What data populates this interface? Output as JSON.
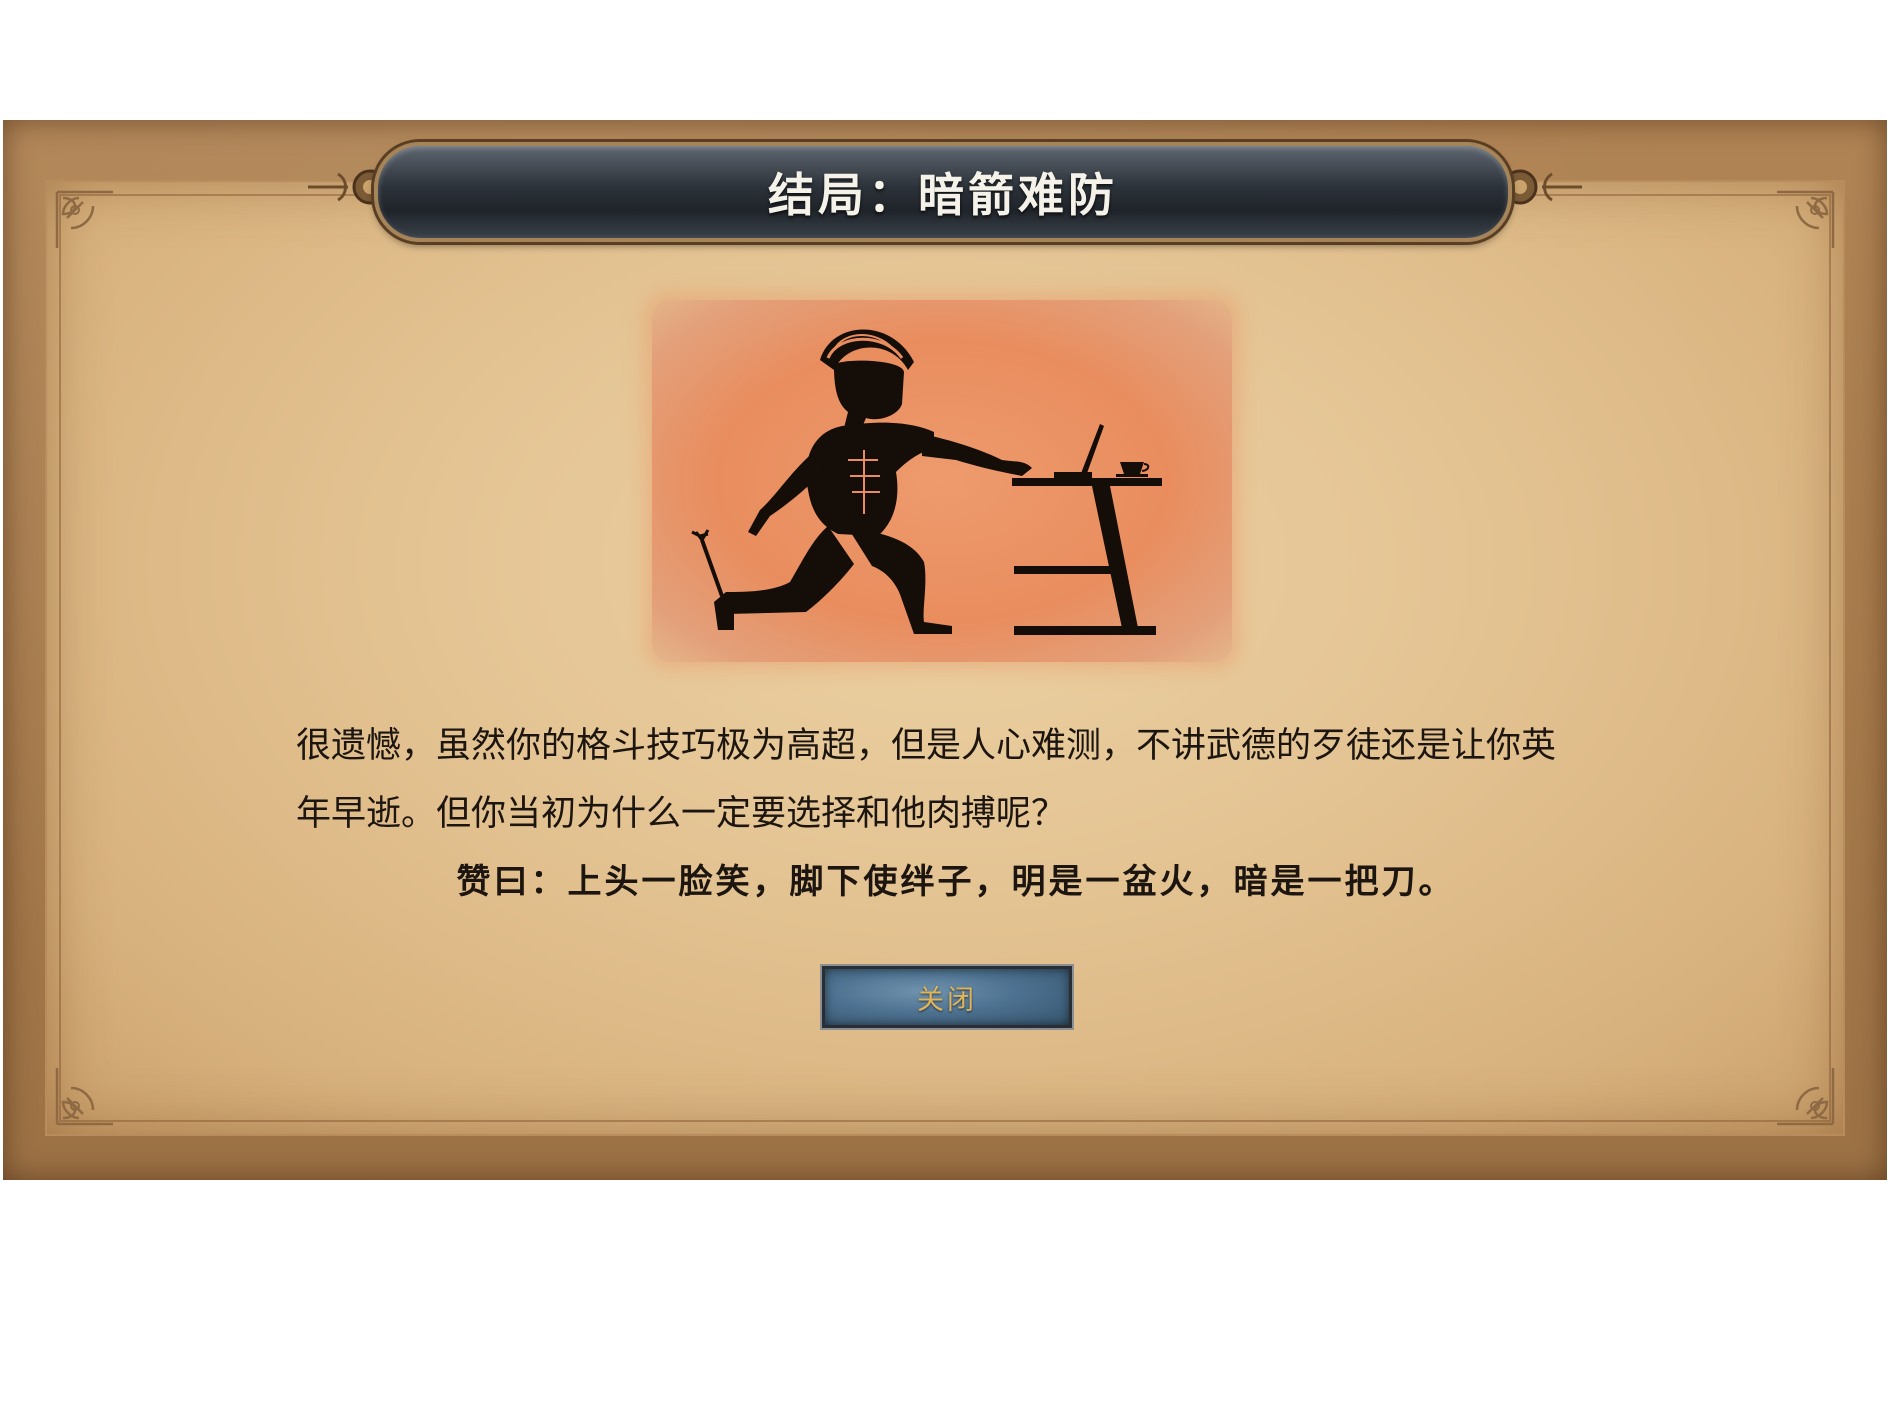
{
  "dialog": {
    "title": "结局：暗箭难防",
    "story_line1": "很遗憾，虽然你的格斗技巧极为高超，但是人心难测，不讲武德的歹徒还是让你英",
    "story_line2": "年早逝。但你当初为什么一定要选择和他肉搏呢？",
    "verse": "赞曰：上头一脸笑，脚下使绊子，明是一盆火，暗是一把刀。",
    "close_label": "关闭"
  },
  "illustration": {
    "subject": "kneeling-warrior-with-arrow-in-heel-at-laptop-desk"
  },
  "colors": {
    "frame": "#a77b4c",
    "parchment": "#e3c291",
    "banner": "#2c3239",
    "illustration_bg": "#e98d5e",
    "close_button": "#4d7190",
    "close_label": "#e1b45a"
  }
}
